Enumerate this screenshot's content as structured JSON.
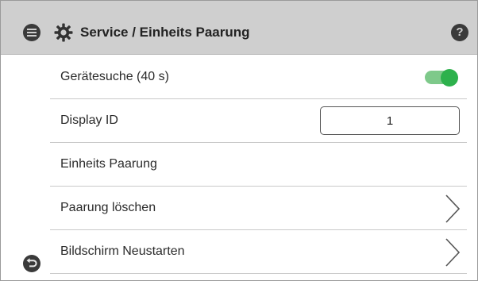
{
  "header": {
    "title": "Service / Einheits Paarung",
    "menu_icon": "menu-icon",
    "settings_icon": "gear-icon",
    "help_icon": "help-icon",
    "help_glyph": "?",
    "background_color": "#cfcfcf"
  },
  "rows": [
    {
      "label": "Gerätesuche (40 s)",
      "control": "toggle",
      "toggle_on": true,
      "accent_color": "#2db14c"
    },
    {
      "label": "Display ID",
      "control": "input",
      "value": "1"
    },
    {
      "label": "Einheits Paarung",
      "control": "none"
    },
    {
      "label": "Paarung löschen",
      "control": "chevron",
      "icon": "chevron-right-icon"
    },
    {
      "label": "Bildschirm Neustarten",
      "control": "chevron",
      "icon": "chevron-right-icon"
    }
  ],
  "footer": {
    "back_icon": "back-icon"
  }
}
